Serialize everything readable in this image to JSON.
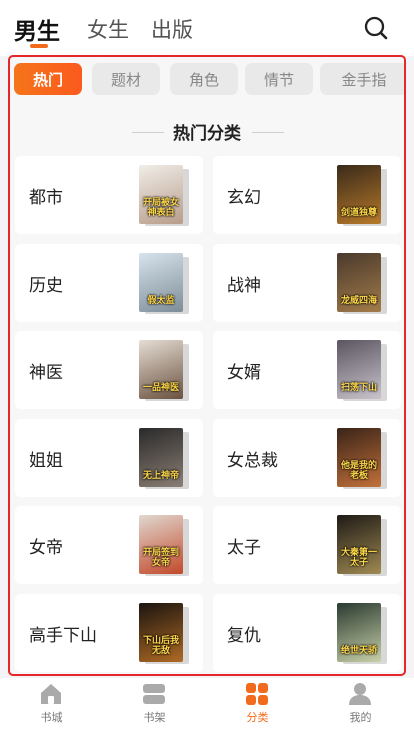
{
  "header": {
    "tabs": [
      {
        "label": "男生",
        "active": true
      },
      {
        "label": "女生",
        "active": false
      },
      {
        "label": "出版",
        "active": false
      }
    ],
    "search_icon": "search-icon"
  },
  "category_tabs": [
    {
      "label": "热门",
      "active": true
    },
    {
      "label": "题材",
      "active": false
    },
    {
      "label": "角色",
      "active": false
    },
    {
      "label": "情节",
      "active": false
    },
    {
      "label": "金手指",
      "active": false
    }
  ],
  "section_title": "热门分类",
  "genres": [
    {
      "label": "都市",
      "cover_text": "开局被女神表白",
      "cover_colors": [
        "#f0ede8",
        "#b79c8a"
      ]
    },
    {
      "label": "玄幻",
      "cover_text": "剑道独尊",
      "cover_colors": [
        "#3a2a1a",
        "#b7792a"
      ]
    },
    {
      "label": "历史",
      "cover_text": "假太监",
      "cover_colors": [
        "#d7e3ec",
        "#7d8d98"
      ]
    },
    {
      "label": "战神",
      "cover_text": "龙威四海",
      "cover_colors": [
        "#4a3a2c",
        "#a27b4a"
      ]
    },
    {
      "label": "神医",
      "cover_text": "一品神医",
      "cover_colors": [
        "#e6ddd4",
        "#6a5240"
      ]
    },
    {
      "label": "女婿",
      "cover_text": "扫荡下山",
      "cover_colors": [
        "#5a5560",
        "#c9c4cc"
      ]
    },
    {
      "label": "姐姐",
      "cover_text": "无上神帝",
      "cover_colors": [
        "#2a2a2a",
        "#8a7e74"
      ]
    },
    {
      "label": "女总裁",
      "cover_text": "他是我的老板",
      "cover_colors": [
        "#3a2418",
        "#c2703a"
      ]
    },
    {
      "label": "女帝",
      "cover_text": "开局签到女帝",
      "cover_colors": [
        "#e0d8d0",
        "#c2482a"
      ]
    },
    {
      "label": "太子",
      "cover_text": "大秦第一太子",
      "cover_colors": [
        "#1e1a16",
        "#a08a52"
      ]
    },
    {
      "label": "高手下山",
      "cover_text": "下山后我无敌",
      "cover_colors": [
        "#1a1410",
        "#b06a24"
      ]
    },
    {
      "label": "复仇",
      "cover_text": "绝世天骄",
      "cover_colors": [
        "#2a3a30",
        "#c7d0a8"
      ]
    }
  ],
  "bottom_nav": [
    {
      "label": "书城",
      "icon": "home-icon",
      "active": false
    },
    {
      "label": "书架",
      "icon": "bookshelf-icon",
      "active": false
    },
    {
      "label": "分类",
      "icon": "category-grid-icon",
      "active": true
    },
    {
      "label": "我的",
      "icon": "profile-icon",
      "active": false
    }
  ],
  "colors": {
    "accent": "#f26a1b",
    "highlight_frame": "#e5262a",
    "inactive_text": "#888888"
  }
}
